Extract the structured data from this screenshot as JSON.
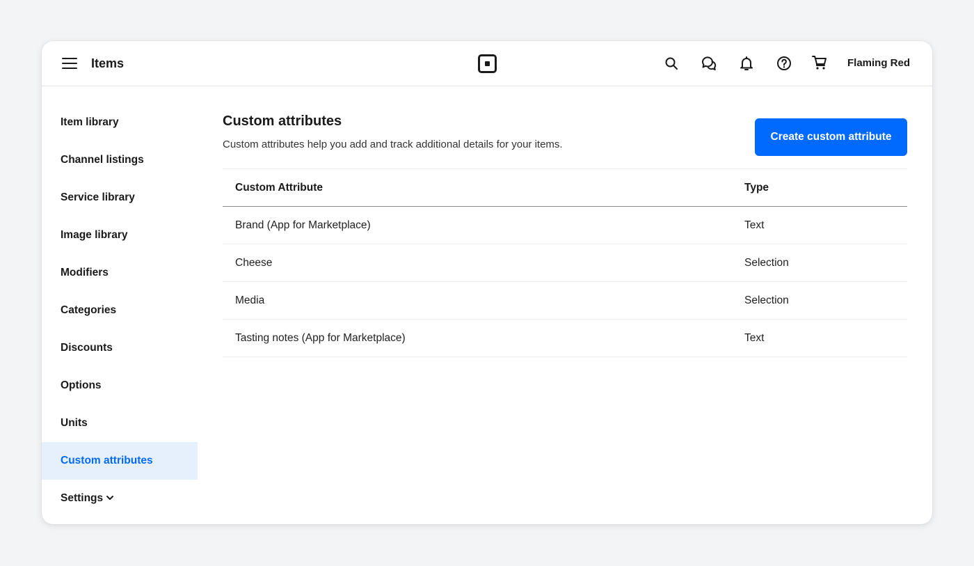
{
  "header": {
    "title": "Items",
    "account_name": "Flaming Red",
    "icons": [
      "menu-icon",
      "square-logo",
      "search-icon",
      "messages-icon",
      "bell-icon",
      "help-icon",
      "cart-icon"
    ]
  },
  "sidebar": {
    "items": [
      {
        "label": "Item library"
      },
      {
        "label": "Channel listings"
      },
      {
        "label": "Service library"
      },
      {
        "label": "Image library"
      },
      {
        "label": "Modifiers"
      },
      {
        "label": "Categories"
      },
      {
        "label": "Discounts"
      },
      {
        "label": "Options"
      },
      {
        "label": "Units"
      },
      {
        "label": "Custom attributes",
        "active": true
      },
      {
        "label": "Settings",
        "expandable": true
      }
    ]
  },
  "main": {
    "title": "Custom attributes",
    "description": "Custom attributes help you add and track additional details for your items.",
    "create_button": "Create custom attribute",
    "table": {
      "columns": [
        "Custom Attribute",
        "Type"
      ],
      "rows": [
        {
          "name": "Brand (App for Marketplace)",
          "type": "Text"
        },
        {
          "name": "Cheese",
          "type": "Selection"
        },
        {
          "name": "Media",
          "type": "Selection"
        },
        {
          "name": "Tasting notes (App for Marketplace)",
          "type": "Text"
        }
      ]
    }
  },
  "colors": {
    "accent": "#006aff",
    "active_nav_bg": "#e6f0fd",
    "page_bg": "#f3f4f6"
  }
}
